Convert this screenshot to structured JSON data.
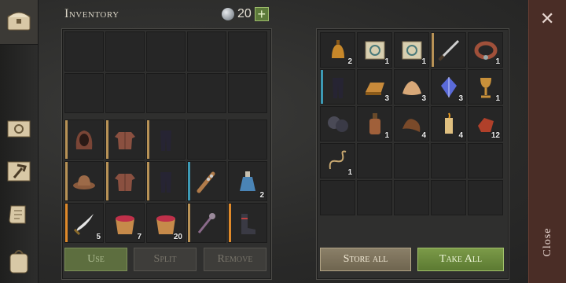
{
  "header": {
    "title": "Inventory",
    "currency": "20",
    "add_label": "+"
  },
  "nav": {
    "icons": [
      "chest-icon",
      "journal-icon",
      "crafting-hammer-icon",
      "scroll-icon",
      "backpack-icon"
    ]
  },
  "left": {
    "rows": [
      [
        null,
        null,
        null,
        null,
        null
      ],
      [
        null,
        null,
        null,
        null,
        null
      ],
      [
        {
          "i": "hood",
          "b": "#b89256"
        },
        {
          "i": "tunic",
          "b": "#b89256"
        },
        {
          "i": "pants",
          "b": "#b89256"
        },
        null,
        null
      ],
      [
        {
          "i": "hat",
          "b": "#b89256"
        },
        {
          "i": "tunic",
          "b": "#b89256"
        },
        {
          "i": "pants",
          "b": "#b89256"
        },
        {
          "i": "club",
          "b": "#3d9ab5"
        },
        {
          "i": "potion",
          "q": "2"
        }
      ],
      [
        {
          "i": "sword",
          "b": "#e08a2a",
          "q": "5"
        },
        {
          "i": "basket",
          "q": "7"
        },
        {
          "i": "basket",
          "q": "20"
        },
        {
          "i": "mace",
          "b": "#b89256"
        },
        {
          "i": "boots",
          "b": "#e08a2a"
        }
      ]
    ],
    "buttons": {
      "use": "Use",
      "split": "Split",
      "remove": "Remove"
    }
  },
  "right": {
    "rows": [
      [
        {
          "i": "bell",
          "q": "2"
        },
        {
          "i": "map",
          "q": "1"
        },
        {
          "i": "map",
          "q": "1"
        },
        {
          "i": "blade",
          "b": "#b89256"
        },
        {
          "i": "collar",
          "q": "1"
        }
      ],
      [
        {
          "i": "pants",
          "b": "#3d9ab5"
        },
        {
          "i": "ingot",
          "q": "3"
        },
        {
          "i": "cloth",
          "q": "3"
        },
        {
          "i": "crystal",
          "q": "3"
        },
        {
          "i": "goblet",
          "q": "1"
        }
      ],
      [
        {
          "i": "ore"
        },
        {
          "i": "bottle",
          "q": "1"
        },
        {
          "i": "leather",
          "q": "4"
        },
        {
          "i": "candle",
          "q": "4"
        },
        {
          "i": "scraps",
          "q": "12"
        }
      ],
      [
        {
          "i": "rope",
          "q": "1"
        },
        null,
        null,
        null,
        null
      ],
      [
        null,
        null,
        null,
        null,
        null
      ]
    ],
    "buttons": {
      "store": "Store all",
      "take": "Take All"
    }
  },
  "close": {
    "label": "Close",
    "x": "✕"
  }
}
